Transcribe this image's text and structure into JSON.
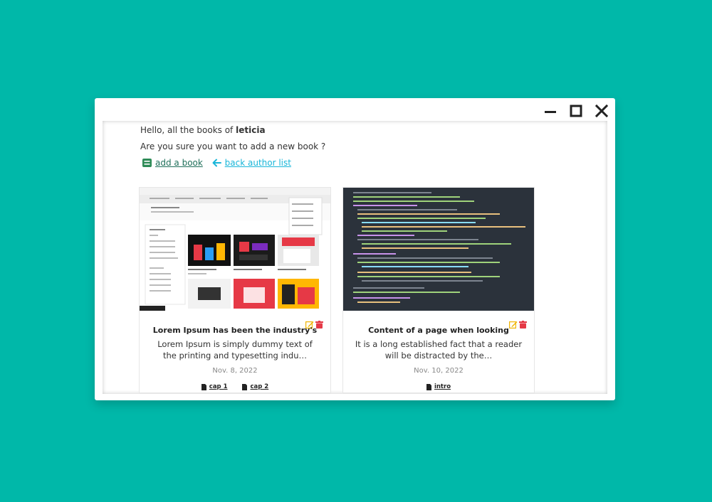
{
  "greeting": {
    "prefix": "Hello, all the books of",
    "author": "leticia"
  },
  "confirm_text": "Are you sure you want to add a new book ?",
  "links": {
    "add_book": "add a book",
    "back": "back author list"
  },
  "books": [
    {
      "title": "Lorem Ipsum has been the industry's",
      "description": "Lorem Ipsum is simply dummy text of the printing and typesetting indu…",
      "date": "Nov. 8, 2022",
      "chapters": [
        "cap 1",
        "cap 2"
      ]
    },
    {
      "title": "Content of a page when looking",
      "description": "It is a long established fact that a reader will be distracted by the…",
      "date": "Nov. 10, 2022",
      "chapters": [
        "intro"
      ]
    }
  ],
  "icons": {
    "minimize": "minimize-icon",
    "maximize": "maximize-icon",
    "close": "close-icon",
    "add_book": "book-icon",
    "back": "arrow-left-icon",
    "edit": "edit-icon",
    "delete": "trash-icon",
    "chapter": "file-icon"
  },
  "colors": {
    "background": "#00b8a9",
    "add_link": "#1f6f5a",
    "back_link": "#19b6d9",
    "edit": "#f0b400",
    "delete": "#e53946"
  }
}
